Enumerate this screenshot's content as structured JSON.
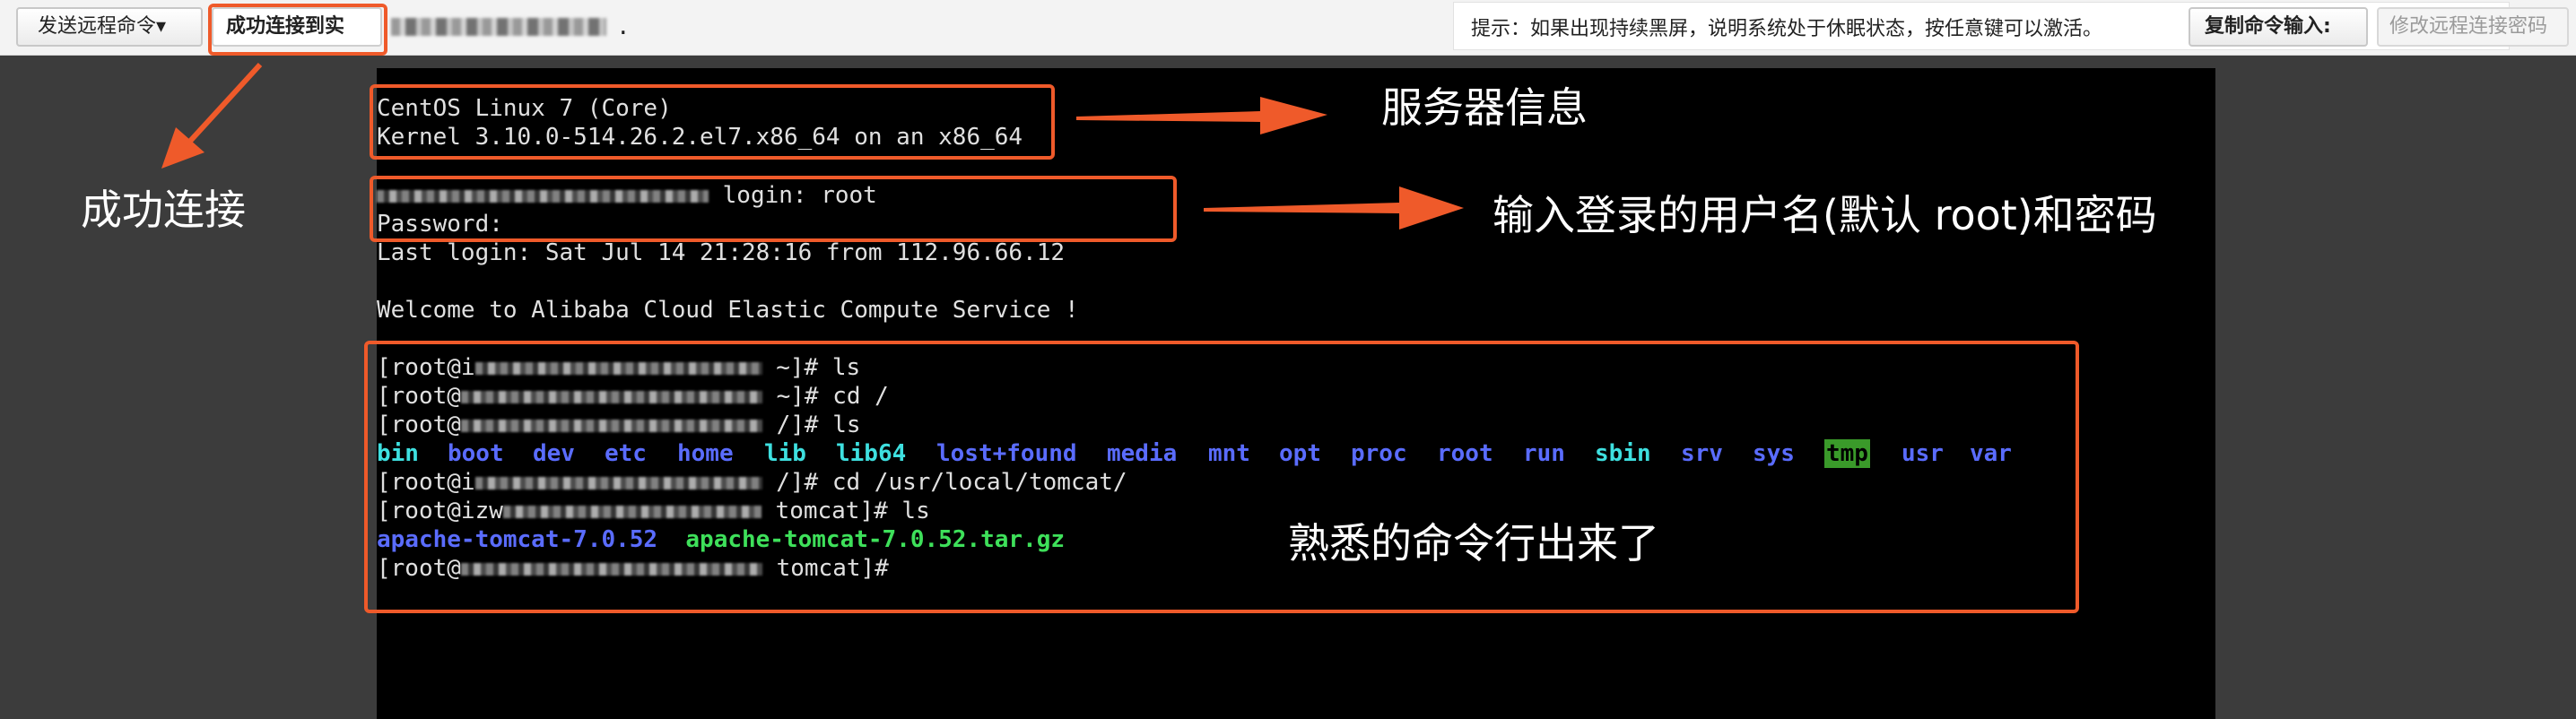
{
  "toolbar": {
    "send_button": "发送远程命令▾",
    "status_button": "成功连接到实",
    "hint": "提示：如果出现持续黑屏，说明系统处于休眠状态，按任意键可以激活。",
    "copy_button": "复制命令输入:",
    "modify_button": "修改远程连接密码"
  },
  "terminal": {
    "os_line": "CentOS Linux 7 (Core)",
    "kernel_line": "Kernel 3.10.0-514.26.2.el7.x86_64 on an x86_64",
    "login_suffix": " login: root",
    "password_line": "Password:",
    "last_login": "Last login: Sat Jul 14 21:28:16 from 112.96.66.12",
    "welcome": "Welcome to Alibaba Cloud Elastic Compute Service !",
    "prompts": [
      {
        "pre": "[root@i",
        "post": " ~]# ls"
      },
      {
        "pre": "[root@",
        "post": " ~]# cd /"
      },
      {
        "pre": "[root@",
        "post": " /]# ls"
      },
      {
        "pre": "[root@i",
        "post": " /]# cd /usr/local/tomcat/"
      },
      {
        "pre": "[root@izw",
        "post": " tomcat]# ls"
      },
      {
        "pre": "[root@",
        "post": " tomcat]#"
      }
    ],
    "dirs": [
      "bin",
      "boot",
      "dev",
      "etc",
      "home",
      "lib",
      "lib64",
      "lost+found",
      "media",
      "mnt",
      "opt",
      "proc",
      "root",
      "run",
      "sbin",
      "srv",
      "sys",
      "tmp",
      "usr",
      "var"
    ],
    "tomcat_dir": "apache-tomcat-7.0.52",
    "tomcat_archive": "apache-tomcat-7.0.52.tar.gz"
  },
  "annotations": {
    "connected": "成功连接",
    "server_info": "服务器信息",
    "login_info": "输入登录的用户名(默认 root)和密码",
    "command_line": "熟悉的命令行出来了"
  },
  "colors": {
    "annotation": "#ef5a2a",
    "dir_blue": "#5a6cff",
    "dir_cyan": "#3ee0e0",
    "dir_green": "#3ee05a",
    "tmp_bg": "#3a9a2a"
  }
}
